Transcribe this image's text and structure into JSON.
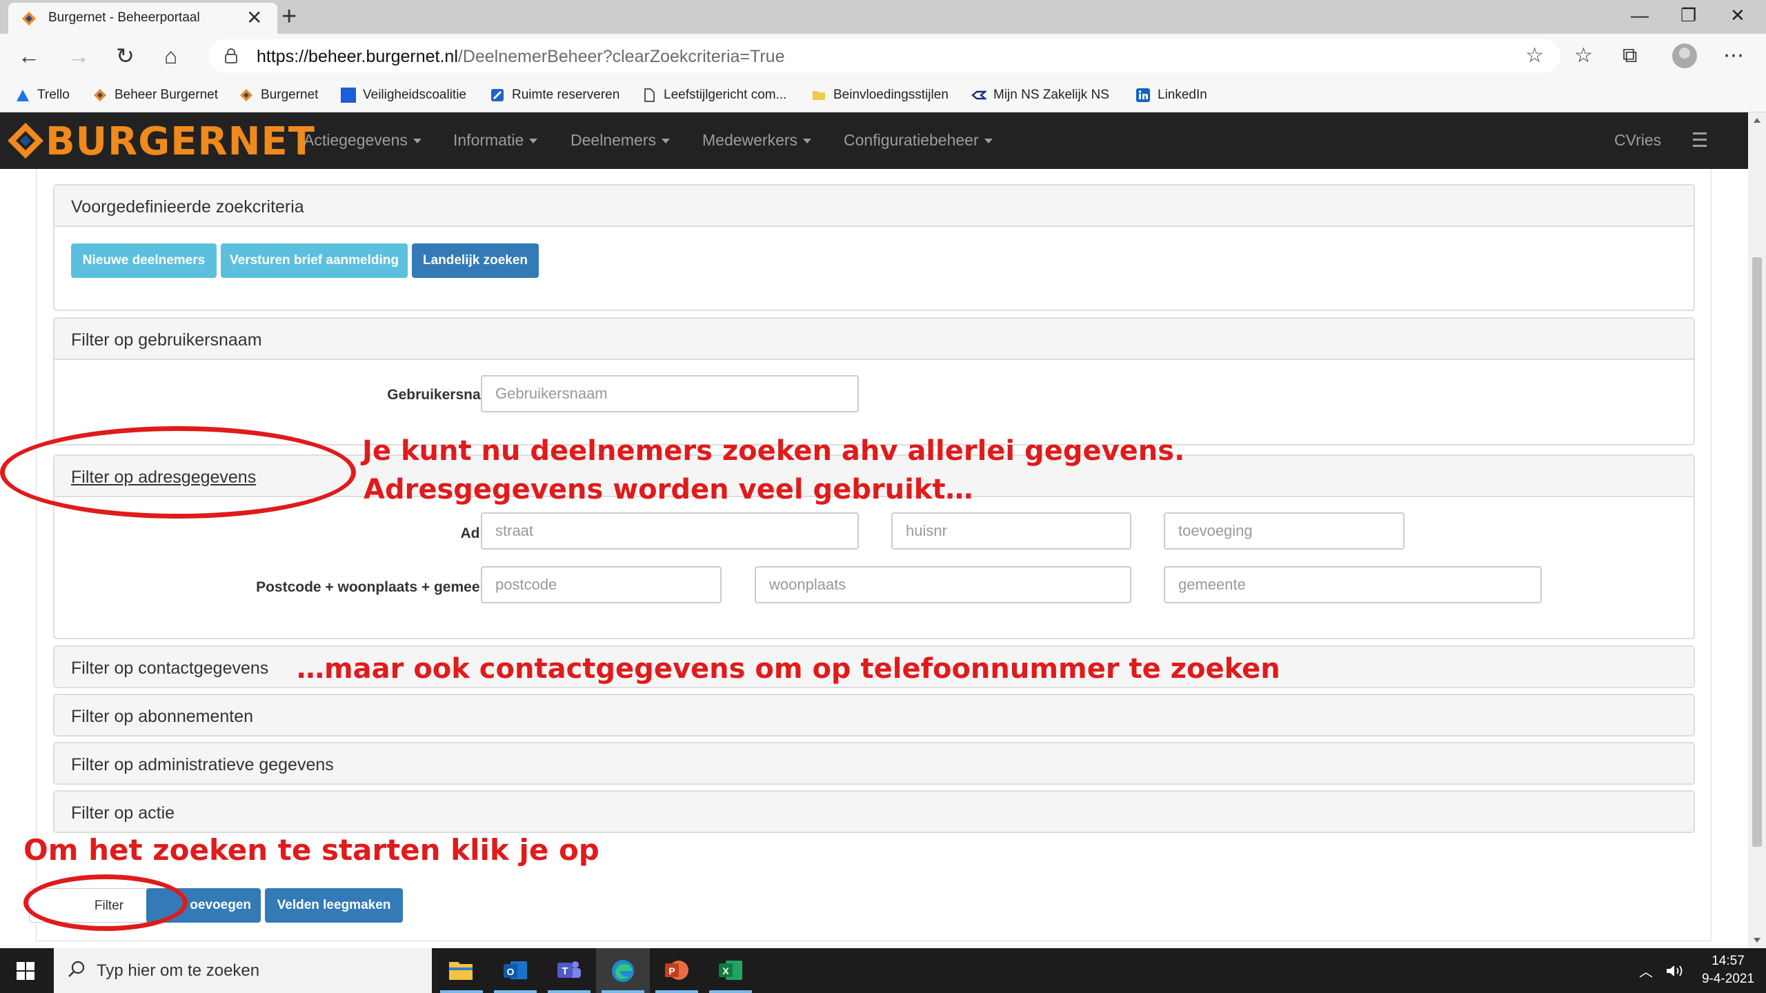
{
  "browser": {
    "tab_title": "Burgernet - Beheerportaal",
    "tab_close": "✕",
    "new_tab": "+",
    "window_controls": {
      "minimize": "—",
      "restore": "❐",
      "close": "✕"
    },
    "url_host": "https://beheer.burgernet.nl",
    "url_path": "/DeelnemerBeheer?clearZoekcriteria=True",
    "nav": {
      "back": "←",
      "forward": "→",
      "reload": "↻",
      "home": "⌂"
    },
    "toolbar": {
      "favorites": "☆",
      "collections": "⧉",
      "more": "⋯",
      "add_fav": "☆"
    }
  },
  "bookmarks": [
    {
      "label": "Trello"
    },
    {
      "label": "Beheer Burgernet"
    },
    {
      "label": "Burgernet"
    },
    {
      "label": "Veiligheidscoalitie"
    },
    {
      "label": "Ruimte reserveren"
    },
    {
      "label": "Leefstijlgericht com..."
    },
    {
      "label": "Beinvloedingsstijlen"
    },
    {
      "label": "Mijn NS Zakelijk  NS"
    },
    {
      "label": "LinkedIn"
    }
  ],
  "site": {
    "logo": "BURGERNET",
    "menu": [
      {
        "label": "Actiegegevens"
      },
      {
        "label": "Informatie"
      },
      {
        "label": "Deelnemers"
      },
      {
        "label": "Medewerkers"
      },
      {
        "label": "Configuratiebeheer"
      }
    ],
    "user": "CVries"
  },
  "panels": {
    "predefined": {
      "title": "Voorgedefinieerde zoekcriteria",
      "buttons": {
        "new_participants": "Nieuwe deelnemers",
        "send_letter": "Versturen brief aanmelding",
        "national_search": "Landelijk zoeken"
      }
    },
    "username": {
      "title": "Filter op gebruikersnaam",
      "label": "Gebruikersnaam",
      "placeholder": "Gebruikersnaam"
    },
    "address": {
      "title": "Filter op adresgegevens",
      "address_label": "Adres",
      "street_ph": "straat",
      "number_ph": "huisnr",
      "addition_ph": "toevoeging",
      "postal_label": "Postcode + woonplaats + gemeente",
      "postcode_ph": "postcode",
      "city_ph": "woonplaats",
      "municipality_ph": "gemeente"
    },
    "contact": {
      "title": "Filter op contactgegevens"
    },
    "subscriptions": {
      "title": "Filter op abonnementen"
    },
    "admin": {
      "title": "Filter op administratieve gegevens"
    },
    "action": {
      "title": "Filter op actie"
    }
  },
  "footer_buttons": {
    "filter": "Filter",
    "add_partial": "oevoegen",
    "clear": "Velden leegmaken"
  },
  "annotations": {
    "line1": "Je kunt nu deelnemers zoeken ahv allerlei gegevens.",
    "line2": "Adresgegevens worden veel gebruikt…",
    "line3": "…maar ook contactgegevens om op telefoonnummer te zoeken",
    "line4": "Om het zoeken te starten klik je op"
  },
  "taskbar": {
    "search_placeholder": "Typ hier om te zoeken",
    "time": "14:57",
    "date": "9-4-2021"
  },
  "colors": {
    "navbar": "#222222",
    "brand_orange": "#f08a1c",
    "btn_info": "#5bc0de",
    "btn_primary": "#337ab7",
    "annotation_red": "#e01b1b"
  }
}
